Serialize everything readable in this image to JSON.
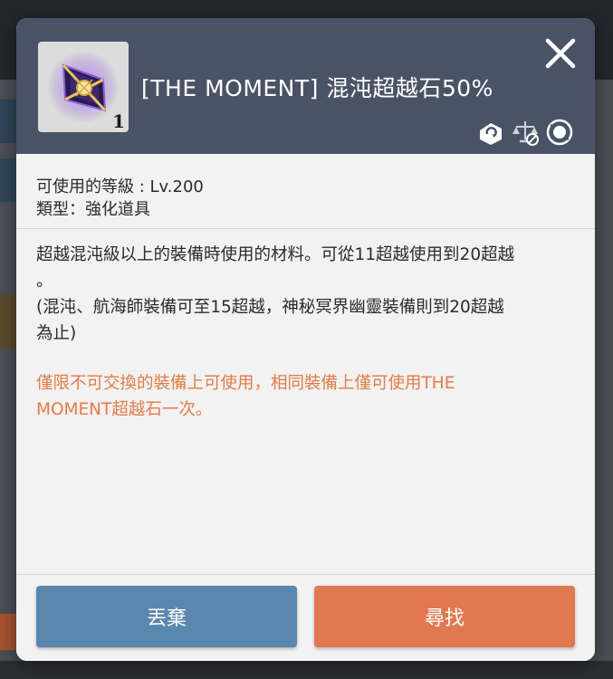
{
  "item": {
    "title": "[THE MOMENT] 混沌超越石50%",
    "quantity": "1",
    "icon": "crystal-stone-icon"
  },
  "header_icons": [
    "trade-icon",
    "scale-blocked-icon",
    "refresh-icon"
  ],
  "meta": {
    "level": "可使用的等級 : Lv.200",
    "type": "類型：強化道具"
  },
  "description": {
    "line1": "超越混沌級以上的裝備時使用的材料。可從11超越使用到20超越",
    "line2": "。",
    "line3": "(混沌、航海師裝備可至15超越，神秘冥界幽靈裝備則到20超越",
    "line4": "為止)",
    "warning1": "僅限不可交換的裝備上可使用，相同裝備上僅可使用THE",
    "warning2": "MOMENT超越石一次。"
  },
  "buttons": {
    "discard": "丟棄",
    "find": "尋找"
  },
  "colors": {
    "header": "#4a5366",
    "warning": "#e57c45",
    "discard": "#5a87ae",
    "find": "#e27850"
  }
}
